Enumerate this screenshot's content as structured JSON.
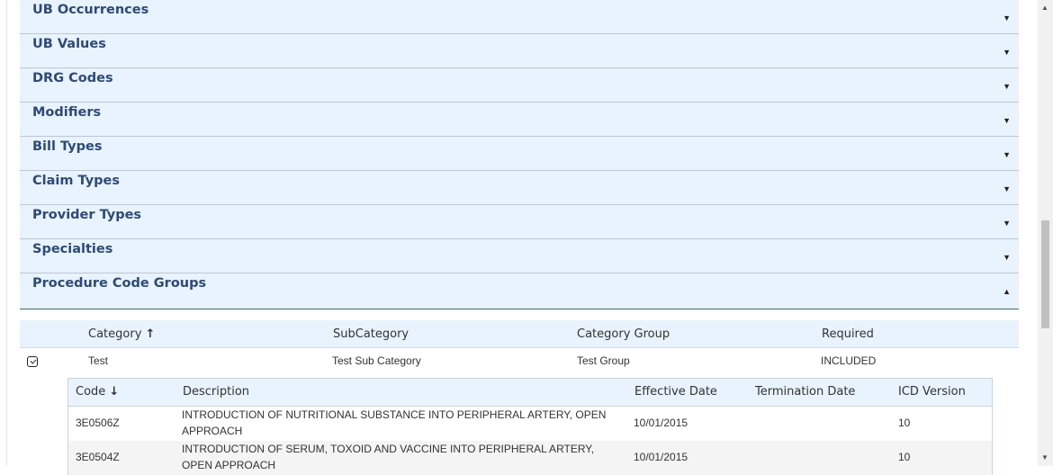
{
  "sections": [
    {
      "label": "UB Occurrences",
      "arrow": "▼"
    },
    {
      "label": "UB Values",
      "arrow": "▼"
    },
    {
      "label": "DRG Codes",
      "arrow": "▼"
    },
    {
      "label": "Modifiers",
      "arrow": "▼"
    },
    {
      "label": "Bill Types",
      "arrow": "▼"
    },
    {
      "label": "Claim Types",
      "arrow": "▼"
    },
    {
      "label": "Provider Types",
      "arrow": "▼"
    },
    {
      "label": "Specialties",
      "arrow": "▼"
    },
    {
      "label": "Procedure Code Groups",
      "arrow": "▲"
    }
  ],
  "groups_table": {
    "headers": {
      "category": "Category",
      "sort_icon": "↑",
      "subcategory": "SubCategory",
      "category_group": "Category Group",
      "required": "Required"
    },
    "rows": [
      {
        "category": "Test",
        "subcategory": "Test Sub Category",
        "category_group": "Test Group",
        "required": "INCLUDED"
      }
    ]
  },
  "codes_table": {
    "headers": {
      "code": "Code",
      "sort_icon": "↓",
      "description": "Description",
      "effective_date": "Effective Date",
      "termination_date": "Termination Date",
      "icd_version": "ICD Version"
    },
    "rows": [
      {
        "code": "3E0506Z",
        "description": "INTRODUCTION OF NUTRITIONAL SUBSTANCE INTO PERIPHERAL ARTERY, OPEN APPROACH",
        "effective_date": "10/01/2015",
        "termination_date": "",
        "icd_version": "10"
      },
      {
        "code": "3E0504Z",
        "description": "INTRODUCTION OF SERUM, TOXOID AND VACCINE INTO PERIPHERAL ARTERY, OPEN APPROACH",
        "effective_date": "10/01/2015",
        "termination_date": "",
        "icd_version": "10"
      }
    ]
  },
  "scrollbar": {
    "up": "▲",
    "down": "▼"
  }
}
